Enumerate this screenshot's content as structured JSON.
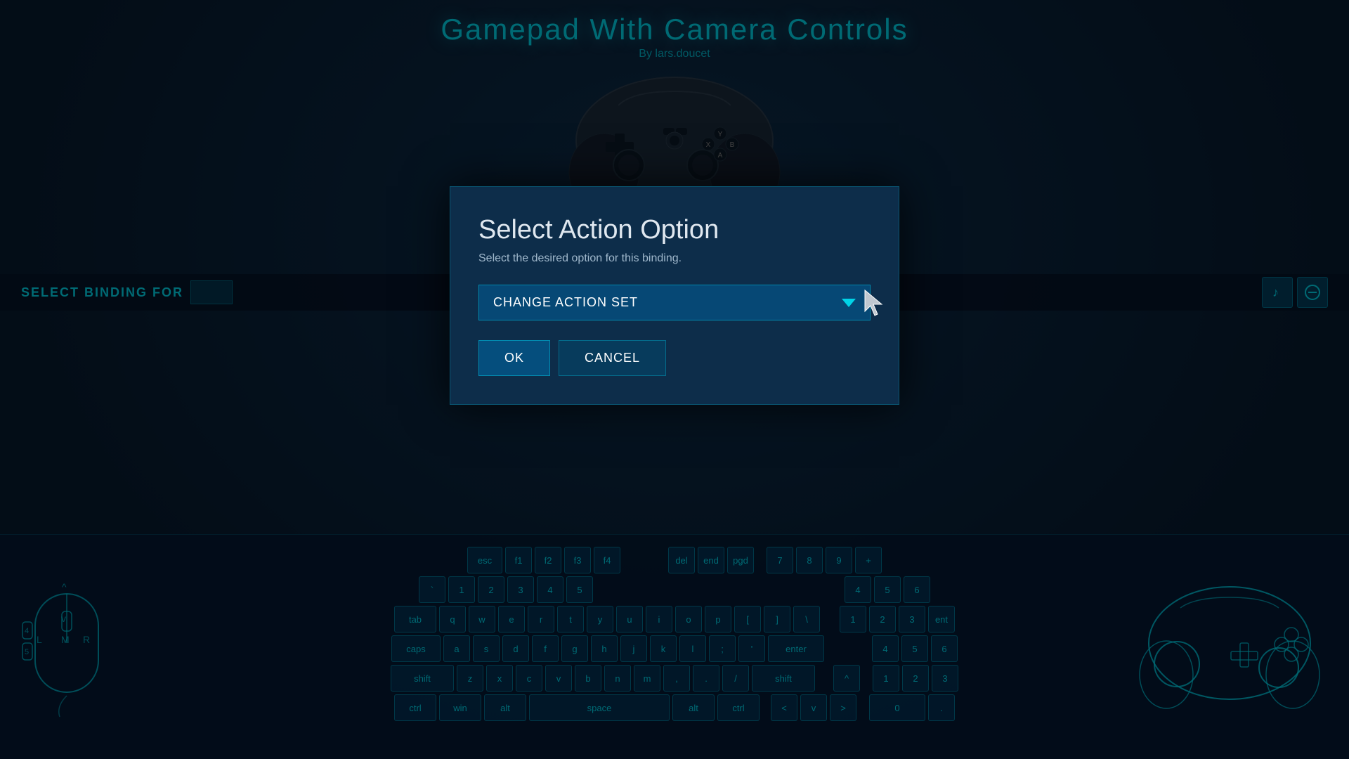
{
  "page": {
    "title": "Gamepad With Camera Controls",
    "subtitle": "By lars.doucet"
  },
  "binding_bar": {
    "label": "SELECT BINDING FOR",
    "music_icon": "♪",
    "minus_icon": "−"
  },
  "modal": {
    "title": "Select Action Option",
    "subtitle": "Select the desired option for this binding.",
    "dropdown": {
      "selected_value": "CHANGE ACTION SET",
      "options": [
        "CHANGE ACTION SET"
      ]
    },
    "ok_label": "OK",
    "cancel_label": "CANCEL"
  },
  "keyboard": {
    "rows": [
      [
        "esc",
        "F1",
        "F2",
        "F3",
        "F4"
      ],
      [
        "`",
        "1",
        "2",
        "3",
        "4",
        "5"
      ],
      [
        "tab",
        "Q",
        "W",
        "E",
        "R",
        "T",
        "Y",
        "U",
        "I",
        "O",
        "P",
        "[",
        "]",
        "\\"
      ],
      [
        "caps",
        "A",
        "S",
        "D",
        "F",
        "G",
        "H",
        "J",
        "K",
        "L",
        ";",
        "'",
        "enter"
      ],
      [
        "shift",
        "Z",
        "X",
        "C",
        "V",
        "B",
        "N",
        "M",
        ",",
        ".",
        "/",
        "shift"
      ],
      [
        "ctrl",
        "win",
        "alt",
        "space",
        "alt",
        "ctrl"
      ]
    ]
  }
}
